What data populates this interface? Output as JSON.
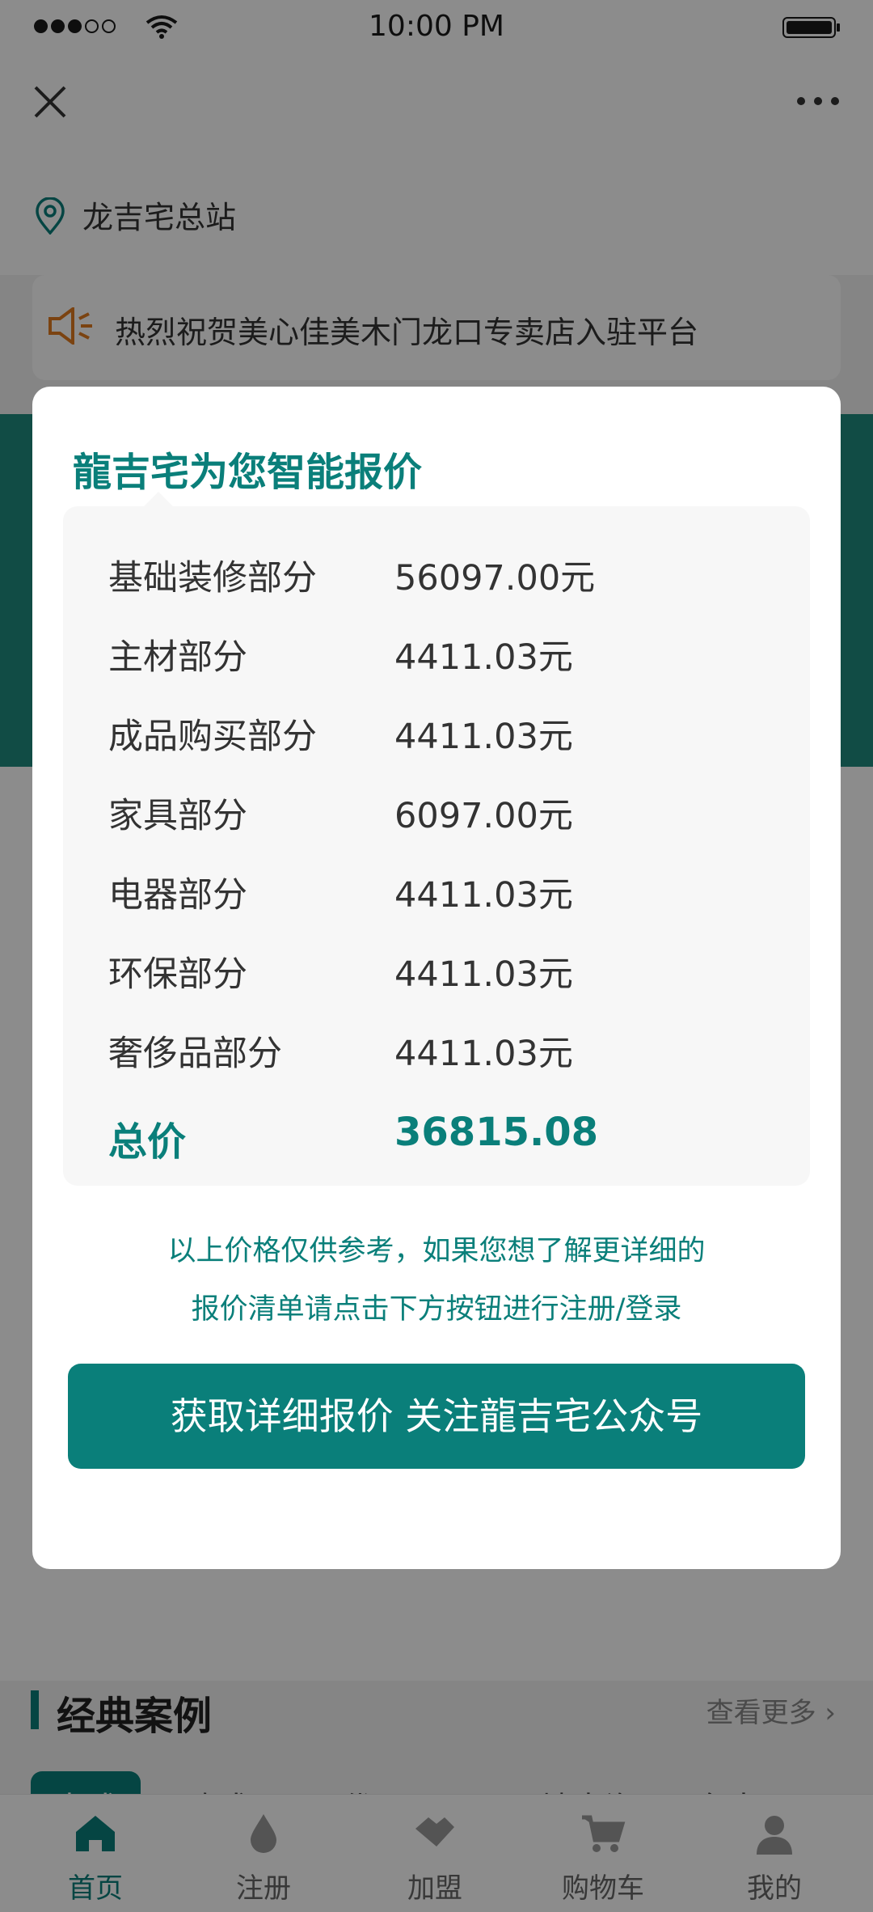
{
  "status_bar": {
    "time": "10:00 PM"
  },
  "location": {
    "name": "龙吉宅总站"
  },
  "notice": {
    "text": "热烈祝贺美心佳美木门龙口专卖店入驻平台"
  },
  "section": {
    "title": "经典案例",
    "more": "查看更多 ›"
  },
  "categories": [
    "中式",
    "欧式",
    "现代",
    "田园",
    "地中海",
    "东南亚"
  ],
  "tabs": [
    {
      "label": "首页",
      "icon": "home-icon"
    },
    {
      "label": "注册",
      "icon": "drop-icon"
    },
    {
      "label": "加盟",
      "icon": "handshake-icon"
    },
    {
      "label": "购物车",
      "icon": "cart-icon"
    },
    {
      "label": "我的",
      "icon": "user-icon"
    }
  ],
  "modal": {
    "title": "龍吉宅为您智能报价",
    "items": [
      {
        "label": "基础装修部分",
        "value": "56097.00元"
      },
      {
        "label": "主材部分",
        "value": "4411.03元"
      },
      {
        "label": "成品购买部分",
        "value": "4411.03元"
      },
      {
        "label": "家具部分",
        "value": "6097.00元"
      },
      {
        "label": "电器部分",
        "value": "4411.03元"
      },
      {
        "label": "环保部分",
        "value": "4411.03元"
      },
      {
        "label": "奢侈品部分",
        "value": "4411.03元"
      }
    ],
    "total": {
      "label": "总价",
      "value": "36815.08"
    },
    "note_line1": "以上价格仅供参考，如果您想了解更详细的",
    "note_line2": "报价清单请点击下方按钮进行注册/登录",
    "cta": "获取详细报价 关注龍吉宅公众号"
  },
  "colors": {
    "accent": "#0a7f7a",
    "banner": "#1f8a7e"
  }
}
